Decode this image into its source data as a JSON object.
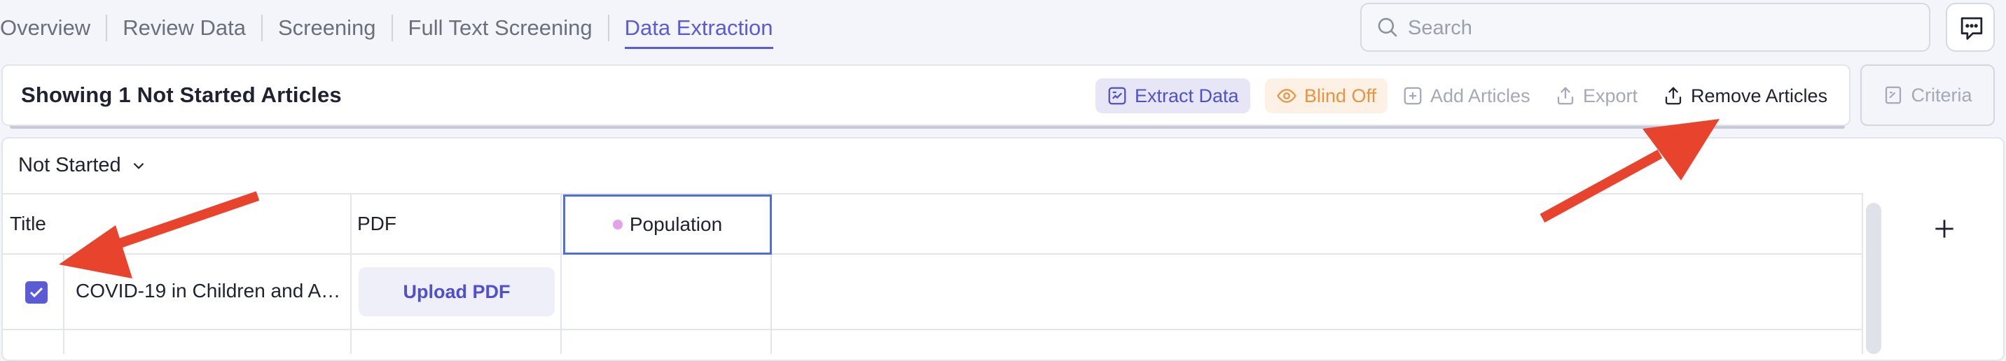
{
  "nav": {
    "tabs": [
      {
        "label": "Overview"
      },
      {
        "label": "Review Data"
      },
      {
        "label": "Screening"
      },
      {
        "label": "Full Text Screening"
      },
      {
        "label": "Data Extraction"
      }
    ]
  },
  "search": {
    "placeholder": "Search"
  },
  "toolbar": {
    "showing": "Showing 1 Not Started Articles",
    "extract_label": "Extract Data",
    "blind_label": "Blind Off",
    "add_label": "Add Articles",
    "export_label": "Export",
    "remove_label": "Remove Articles",
    "criteria_label": "Criteria"
  },
  "filter": {
    "value": "Not Started"
  },
  "table": {
    "headers": {
      "title": "Title",
      "pdf": "PDF",
      "population": "Population"
    },
    "rows": [
      {
        "title": "COVID-19 in Children and A…",
        "pdf_action": "Upload PDF",
        "checked": true
      }
    ]
  },
  "colors": {
    "accent": "#5b5bd6",
    "annotation_arrow": "#e8432c",
    "blind": "#e8943f"
  }
}
